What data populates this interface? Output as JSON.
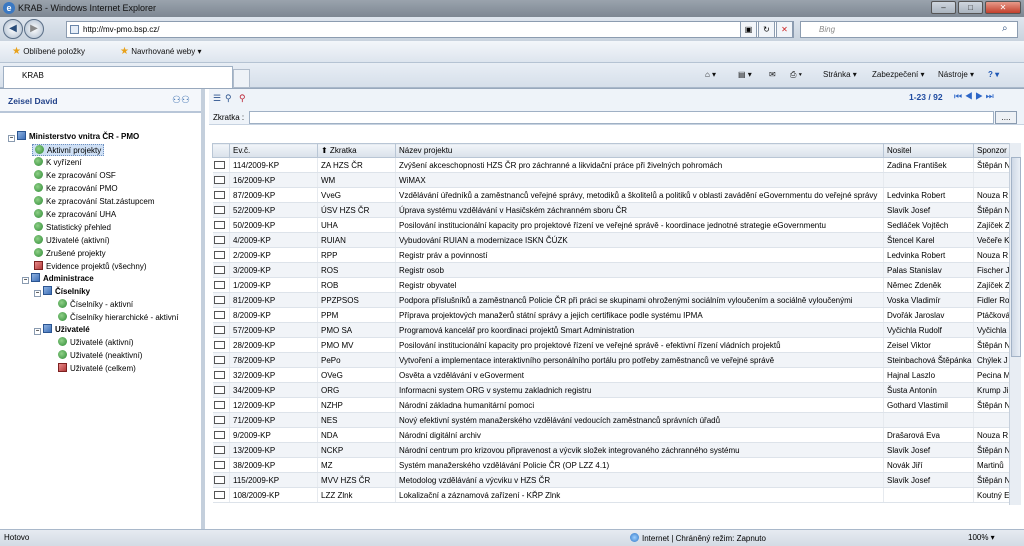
{
  "window": {
    "title": "KRAB - Windows Internet Explorer",
    "minimize": "–",
    "maximize": "□",
    "close": "✕"
  },
  "address": {
    "url": "http://mv-pmo.bsp.cz/",
    "search_placeholder": "Bing"
  },
  "favorites": {
    "fav_label": "Oblíbené položky",
    "suggested_label": "Navrhované weby ▾"
  },
  "tab": {
    "label": "KRAB"
  },
  "commandbar": {
    "page": "Stránka ▾",
    "security": "Zabezpečení ▾",
    "tools": "Nástroje ▾",
    "help": "? ▾"
  },
  "user": {
    "name": "Zeisel David"
  },
  "tree": {
    "root": "Ministerstvo vnitra ČR - PMO",
    "items": [
      "Aktivní projekty",
      "K vyřízení",
      "Ke zpracování OSF",
      "Ke zpracování PMO",
      "Ke zpracování Stat.zástupcem",
      "Ke zpracování UHA",
      "Statistický přehled",
      "Uživatelé (aktivní)",
      "Zrušené projekty",
      "Evidence projektů (všechny)"
    ],
    "admin": "Administrace",
    "ciselniky": "Číselníky",
    "ciselniky_items": [
      "Číselníky - aktivní",
      "Číselníky hierarchické - aktivní"
    ],
    "uzivatele": "Uživatelé",
    "uzivatele_items": [
      "Uživatelé (aktivní)",
      "Uživatelé (neaktivní)",
      "Uživatelé (celkem)"
    ]
  },
  "toolbar": {
    "pager": "1-23 / 92",
    "pager_arrows": "⏮ ◀ ▶ ⏭"
  },
  "filter": {
    "label": "Zkratka :",
    "value": "",
    "button": "...."
  },
  "grid": {
    "columns": [
      "Ev.č.",
      "⬆ Zkratka",
      "Název projektu",
      "Nositel",
      "Sponzor"
    ],
    "rows": [
      [
        "114/2009-KP",
        "ZA HZS ČR",
        "Zvýšení akceschopnosti HZS ČR pro záchranné a likvidační práce při živelných pohromách",
        "Zadina František",
        "Štěpán N"
      ],
      [
        "16/2009-KP",
        "WM",
        "WiMAX",
        "",
        ""
      ],
      [
        "87/2009-KP",
        "VveG",
        "Vzdělávání úředníků a zaměstnanců veřejné správy, metodiků a školitelů a politiků v oblasti zavádění eGovernmentu do veřejné správy",
        "Ledvinka Robert",
        "Nouza R"
      ],
      [
        "52/2009-KP",
        "ÚSV HZS ČR",
        "Úprava systému vzdělávání v Hasičském záchranném sboru ČR",
        "Slavík Josef",
        "Štěpán N"
      ],
      [
        "50/2009-KP",
        "UHA",
        "Posilování institucionální kapacity pro projektové řízení ve veřejné správě - koordinace jednotné strategie eGovernmentu",
        "Sedláček Vojtěch",
        "Zajíček Z"
      ],
      [
        "4/2009-KP",
        "RUIAN",
        "Vybudování RUIAN a modernizace ISKN ČÚZK",
        "Štencel Karel",
        "Večeře K"
      ],
      [
        "2/2009-KP",
        "RPP",
        "Registr práv a povinností",
        "Ledvinka Robert",
        "Nouza R"
      ],
      [
        "3/2009-KP",
        "ROS",
        "Registr osob",
        "Palas Stanislav",
        "Fischer J"
      ],
      [
        "1/2009-KP",
        "ROB",
        "Registr obyvatel",
        "Němec Zdeněk",
        "Zajíček Z"
      ],
      [
        "81/2009-KP",
        "PPZPSOS",
        "Podpora příslušníků a zaměstnanců Policie ČR při práci se skupinami ohroženými sociálním vyloučením a sociálně vyloučenými",
        "Voska Vladimír",
        "Fidler Ro"
      ],
      [
        "8/2009-KP",
        "PPM",
        "Příprava projektových manažerů státní správy a jejich certifikace podle systému IPMA",
        "Dvořák Jaroslav",
        "Ptáčková"
      ],
      [
        "57/2009-KP",
        "PMO SA",
        "Programová kancelář pro koordinaci projektů Smart Administration",
        "Vyčichla Rudolf",
        "Vyčichla"
      ],
      [
        "28/2009-KP",
        "PMO MV",
        "Posilování institucionální kapacity pro projektové řízení ve veřejné správě - efektivní řízení vládních projektů",
        "Zeisel Viktor",
        "Štěpán N"
      ],
      [
        "78/2009-KP",
        "PePo",
        "Vytvoření a implementace interaktivního personálního portálu pro potřeby zaměstnanců ve veřejné správě",
        "Steinbachová Štěpánka",
        "Chýlek J"
      ],
      [
        "32/2009-KP",
        "OVeG",
        "Osvěta a vzdělávání v eGoverment",
        "Hajnal Laszlo",
        "Pecina M"
      ],
      [
        "34/2009-KP",
        "ORG",
        "Informacni system ORG v systemu zakladnich registru",
        "Šusta Antonín",
        "Krump Ji"
      ],
      [
        "12/2009-KP",
        "NZHP",
        "Národní základna humanitární pomoci",
        "Gothard Vlastimil",
        "Štěpán N"
      ],
      [
        "71/2009-KP",
        "NES",
        "Nový efektivní systém manažerského vzdělávání vedoucích zaměstnanců správních úřadů",
        "",
        ""
      ],
      [
        "9/2009-KP",
        "NDA",
        "Národní digitální archiv",
        "Drašarová Eva",
        "Nouza R"
      ],
      [
        "13/2009-KP",
        "NCKP",
        "Národní centrum pro krizovou připravenost a výcvik složek integrovaného záchranného systému",
        "Slavík Josef",
        "Štěpán N"
      ],
      [
        "38/2009-KP",
        "MZ",
        "Systém manažerského vzdělávání Policie ČR (OP LZZ 4.1)",
        "Novák Jiří",
        "Martinů"
      ],
      [
        "115/2009-KP",
        "MVV HZS ČR",
        "Metodolog vzdělávání a výcviku v HZS ČR",
        "Slavík Josef",
        "Štěpán N"
      ],
      [
        "108/2009-KP",
        "LZZ Zlnk",
        "Lokalizační a záznamová zařízení - KŘP Zlnk",
        "",
        "Koutný E"
      ]
    ]
  },
  "status": {
    "left": "Hotovo",
    "zone": "Internet | Chráněný režim: Zapnuto",
    "zoom": "100% ▾"
  }
}
